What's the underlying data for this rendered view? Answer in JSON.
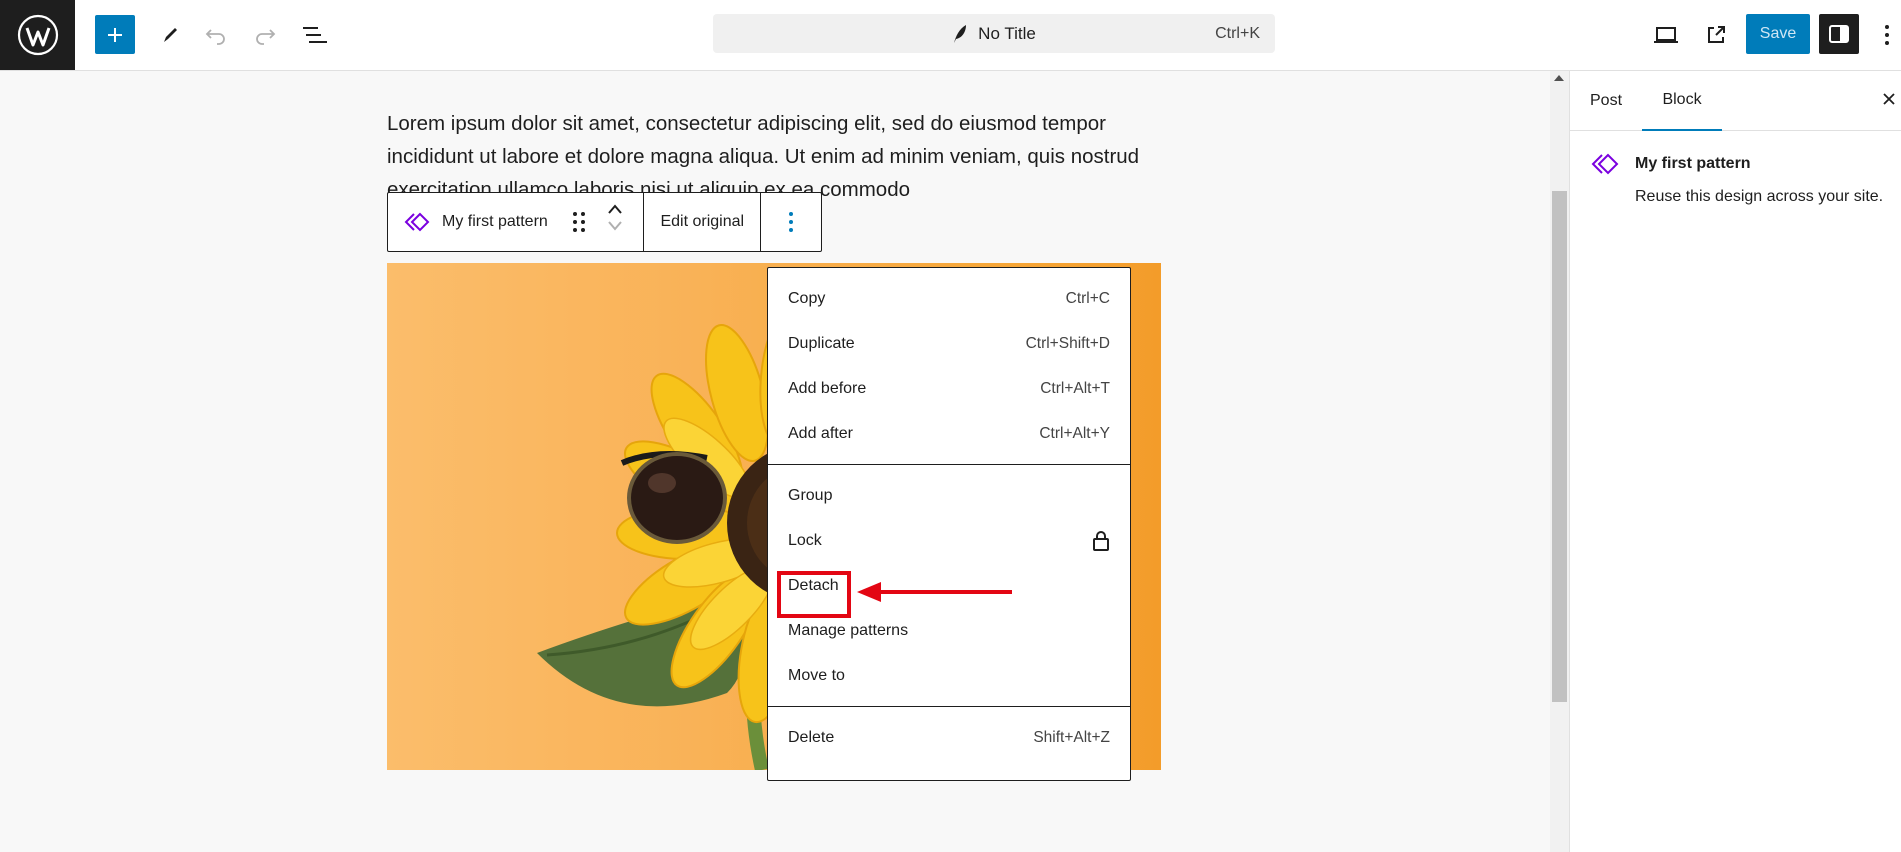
{
  "header": {
    "document_title": "No Title",
    "command_shortcut": "Ctrl+K",
    "save_label": "Save"
  },
  "canvas": {
    "paragraph": "Lorem ipsum dolor sit amet, consectetur adipiscing elit, sed do eiusmod tempor incididunt ut labore et dolore magna aliqua. Ut enim ad minim veniam, quis nostrud exercitation ullamco laboris nisi ut aliquip ex ea commodo"
  },
  "block_toolbar": {
    "pattern_name": "My first pattern",
    "edit_original": "Edit original"
  },
  "menu": {
    "groups": [
      [
        {
          "label": "Copy",
          "shortcut": "Ctrl+C"
        },
        {
          "label": "Duplicate",
          "shortcut": "Ctrl+Shift+D"
        },
        {
          "label": "Add before",
          "shortcut": "Ctrl+Alt+T"
        },
        {
          "label": "Add after",
          "shortcut": "Ctrl+Alt+Y"
        }
      ],
      [
        {
          "label": "Group",
          "shortcut": ""
        },
        {
          "label": "Lock",
          "icon": "lock-icon"
        },
        {
          "label": "Detach",
          "shortcut": ""
        },
        {
          "label": "Manage patterns",
          "shortcut": ""
        },
        {
          "label": "Move to",
          "shortcut": ""
        }
      ],
      [
        {
          "label": "Delete",
          "shortcut": "Shift+Alt+Z"
        }
      ]
    ]
  },
  "sidebar": {
    "tabs": [
      "Post",
      "Block"
    ],
    "active_tab": "Block",
    "block_title": "My first pattern",
    "block_description": "Reuse this design across your site."
  },
  "colors": {
    "accent": "#007cba",
    "pattern_icon": "#7a00df",
    "annotation": "#e30613"
  }
}
